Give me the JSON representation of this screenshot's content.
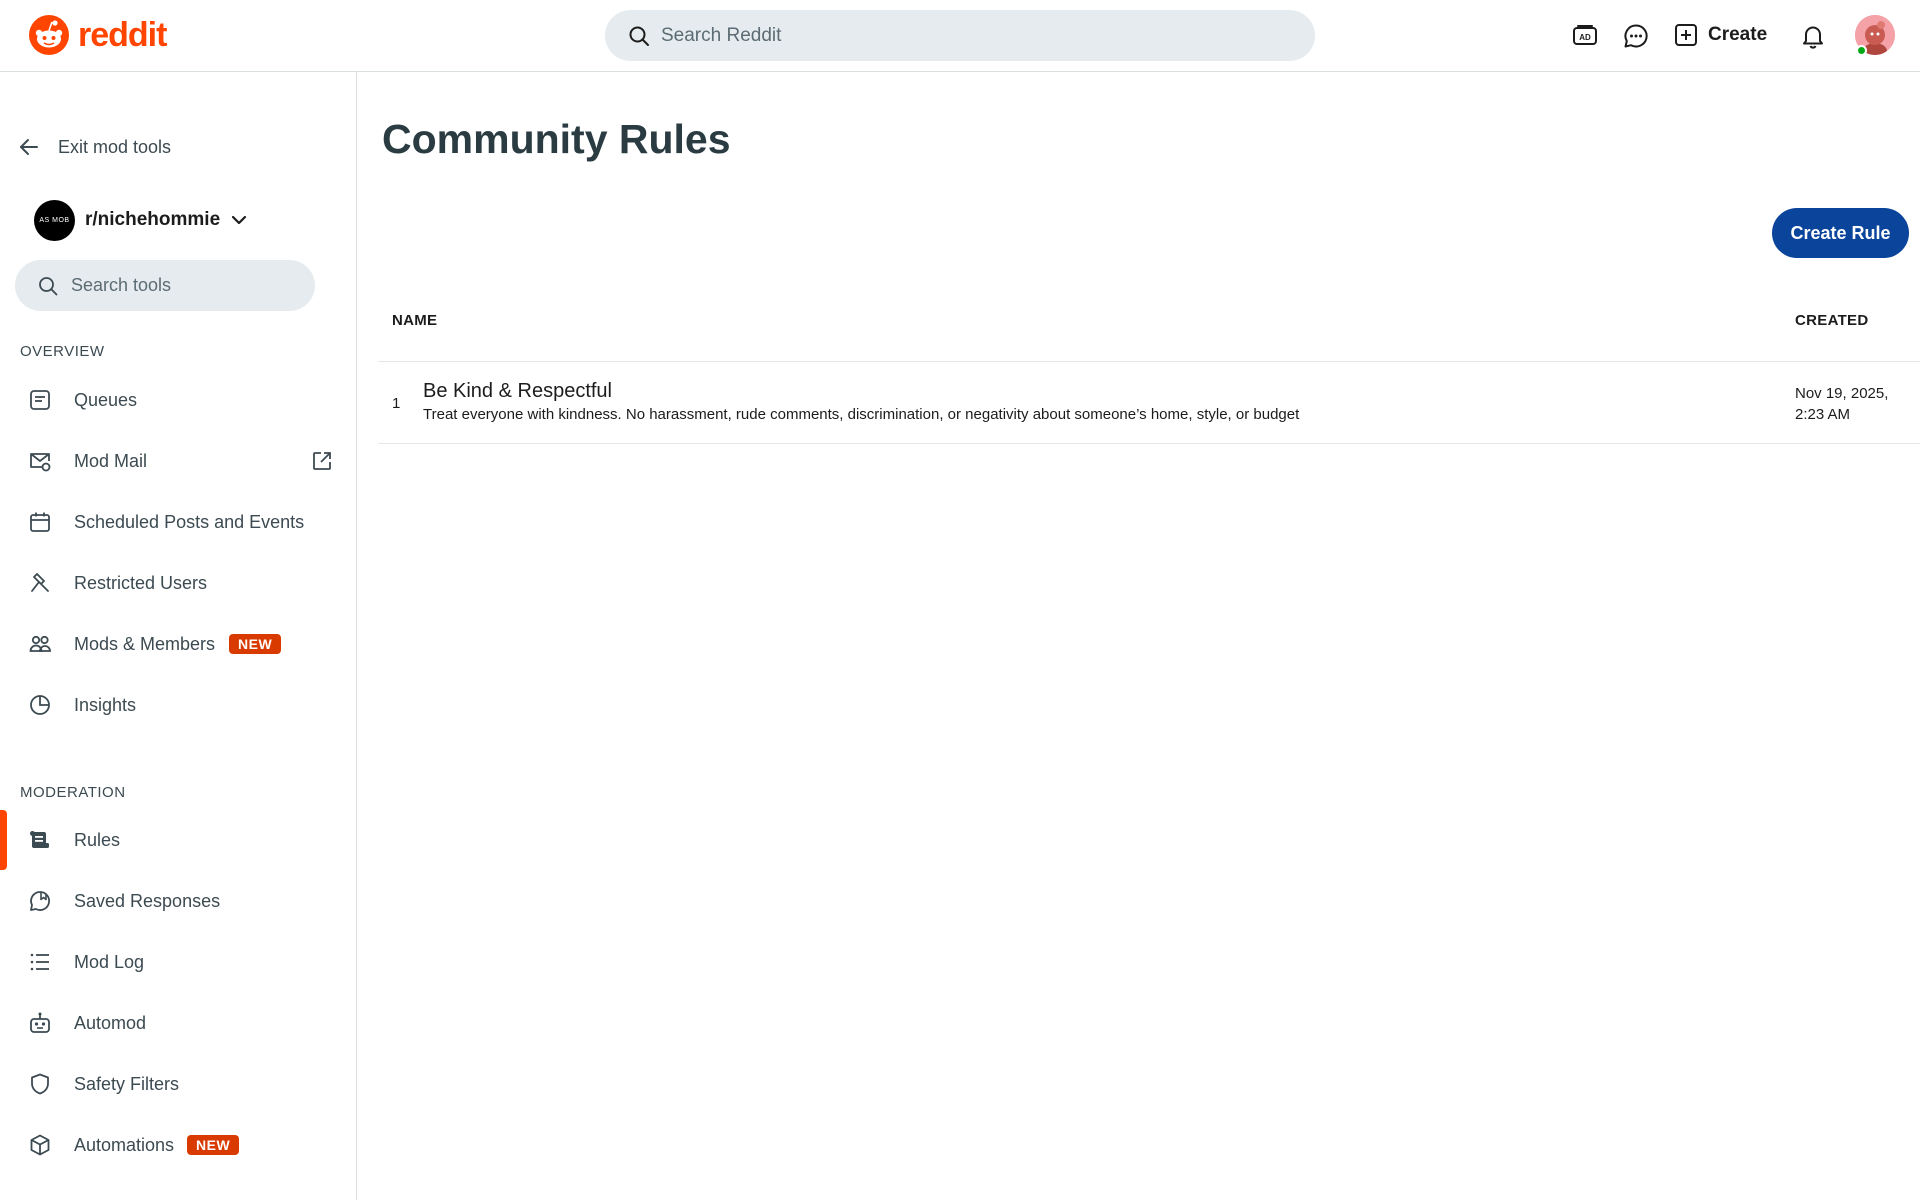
{
  "brand": {
    "name": "reddit",
    "color": "#ff4500"
  },
  "header": {
    "search_placeholder": "Search Reddit",
    "create_label": "Create",
    "icons": [
      "advertise-icon",
      "chat-icon",
      "create-plus-icon",
      "notifications-bell-icon",
      "user-avatar"
    ]
  },
  "sidebar": {
    "exit_label": "Exit mod tools",
    "subreddit": "r/nichehommie",
    "subreddit_avatar_text": "AS MOB",
    "search_placeholder": "Search tools",
    "sections": [
      {
        "title": "OVERVIEW",
        "items": [
          {
            "label": "Queues",
            "icon": "queue-icon"
          },
          {
            "label": "Mod Mail",
            "icon": "mail-icon",
            "external": true
          },
          {
            "label": "Scheduled Posts and Events",
            "icon": "calendar-icon"
          },
          {
            "label": "Restricted Users",
            "icon": "hammer-icon"
          },
          {
            "label": "Mods & Members",
            "icon": "members-icon",
            "badge": "NEW"
          },
          {
            "label": "Insights",
            "icon": "pie-chart-icon"
          }
        ]
      },
      {
        "title": "MODERATION",
        "items": [
          {
            "label": "Rules",
            "icon": "rules-scroll-icon",
            "active": true
          },
          {
            "label": "Saved Responses",
            "icon": "saved-response-icon"
          },
          {
            "label": "Mod Log",
            "icon": "list-icon"
          },
          {
            "label": "Automod",
            "icon": "robot-icon"
          },
          {
            "label": "Safety Filters",
            "icon": "shield-icon"
          },
          {
            "label": "Automations",
            "icon": "cube-icon",
            "badge": "NEW"
          }
        ]
      }
    ]
  },
  "main": {
    "title": "Community Rules",
    "create_button": "Create Rule",
    "columns": {
      "name": "NAME",
      "created": "CREATED"
    },
    "rules": [
      {
        "number": "1",
        "name": "Be Kind & Respectful",
        "description": "Treat everyone with kindness. No harassment, rude comments, discrimination, or negativity about someone’s home, style, or budget",
        "created_line1": "Nov 19, 2025,",
        "created_line2": "2:23 AM"
      }
    ]
  },
  "colors": {
    "accent": "#ff4500",
    "primary_button": "#0a449b",
    "badge": "#d93a00",
    "search_bg": "#e5ebee"
  }
}
